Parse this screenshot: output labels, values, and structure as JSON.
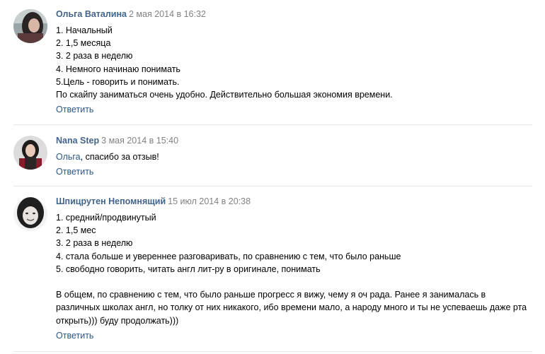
{
  "comments": [
    {
      "author": "Ольга Ваталина",
      "date": "2 мая 2014 в 16:32",
      "lines": [
        "1. Начальный",
        "2. 1,5 месяца",
        "3. 2 раза в неделю",
        "4. Немного начинаю понимать",
        "5.Цель - говорить и понимать.",
        "По скайпу заниматься очень удобно. Действительно большая экономия времени."
      ],
      "reply": "Ответить",
      "avatar_icon": "user-photo-icon"
    },
    {
      "author": "Nana Step",
      "date": "3 мая 2014 в 15:40",
      "mention": "Ольга",
      "text": ", спасибо за отзыв!",
      "reply": "Ответить",
      "avatar_icon": "user-photo-icon"
    },
    {
      "author": "Шпицрутен Непомнящий",
      "date": "15 июл 2014 в 20:38",
      "lines": [
        "1. средний/продвинутый",
        "2. 1,5 мес",
        "3. 2 раза в неделю",
        "4. стала больше и увереннее разговаривать, по сравнению с тем, что было раньше",
        "5. свободно говорить, читать англ лит-ру в оригинале, понимать"
      ],
      "paragraph": "В общем, по сравнению с тем, что было раньше прогресс я вижу, чему я оч рада. Ранее я занималась в различных школах англ, но толку от них никакого, ибо времени мало, а народу много и ты не успеваешь даже рта открыть))) буду продолжать)))",
      "reply": "Ответить",
      "avatar_icon": "user-photo-icon"
    }
  ],
  "colors": {
    "author": "#42648b",
    "date": "#828282",
    "link": "#2a5885",
    "separator": "#e7e8ec"
  }
}
